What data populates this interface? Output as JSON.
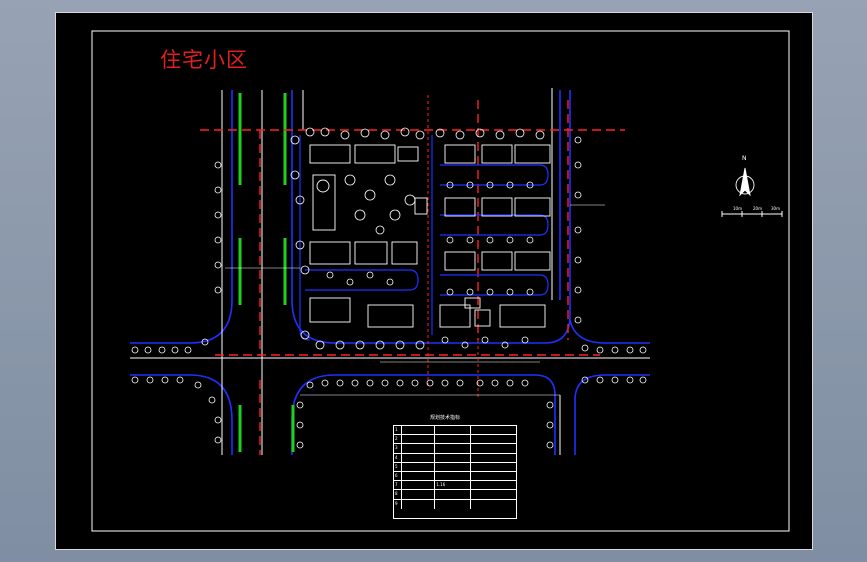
{
  "drawing": {
    "title": "住宅小区",
    "table_title": "规划技术指标",
    "table_rows": [
      [
        "1",
        "",
        "",
        ""
      ],
      [
        "2",
        "",
        "",
        ""
      ],
      [
        "3",
        "",
        "",
        ""
      ],
      [
        "4",
        "",
        "",
        ""
      ],
      [
        "5",
        "",
        "",
        ""
      ],
      [
        "6",
        "",
        "",
        ""
      ],
      [
        "7",
        "",
        "1.16",
        ""
      ],
      [
        "8",
        "",
        "",
        ""
      ],
      [
        "9",
        "",
        "",
        ""
      ]
    ],
    "legend": [
      "",
      ""
    ],
    "north_label": "N",
    "scale_labels": [
      "10m",
      "20m",
      "30m"
    ]
  }
}
